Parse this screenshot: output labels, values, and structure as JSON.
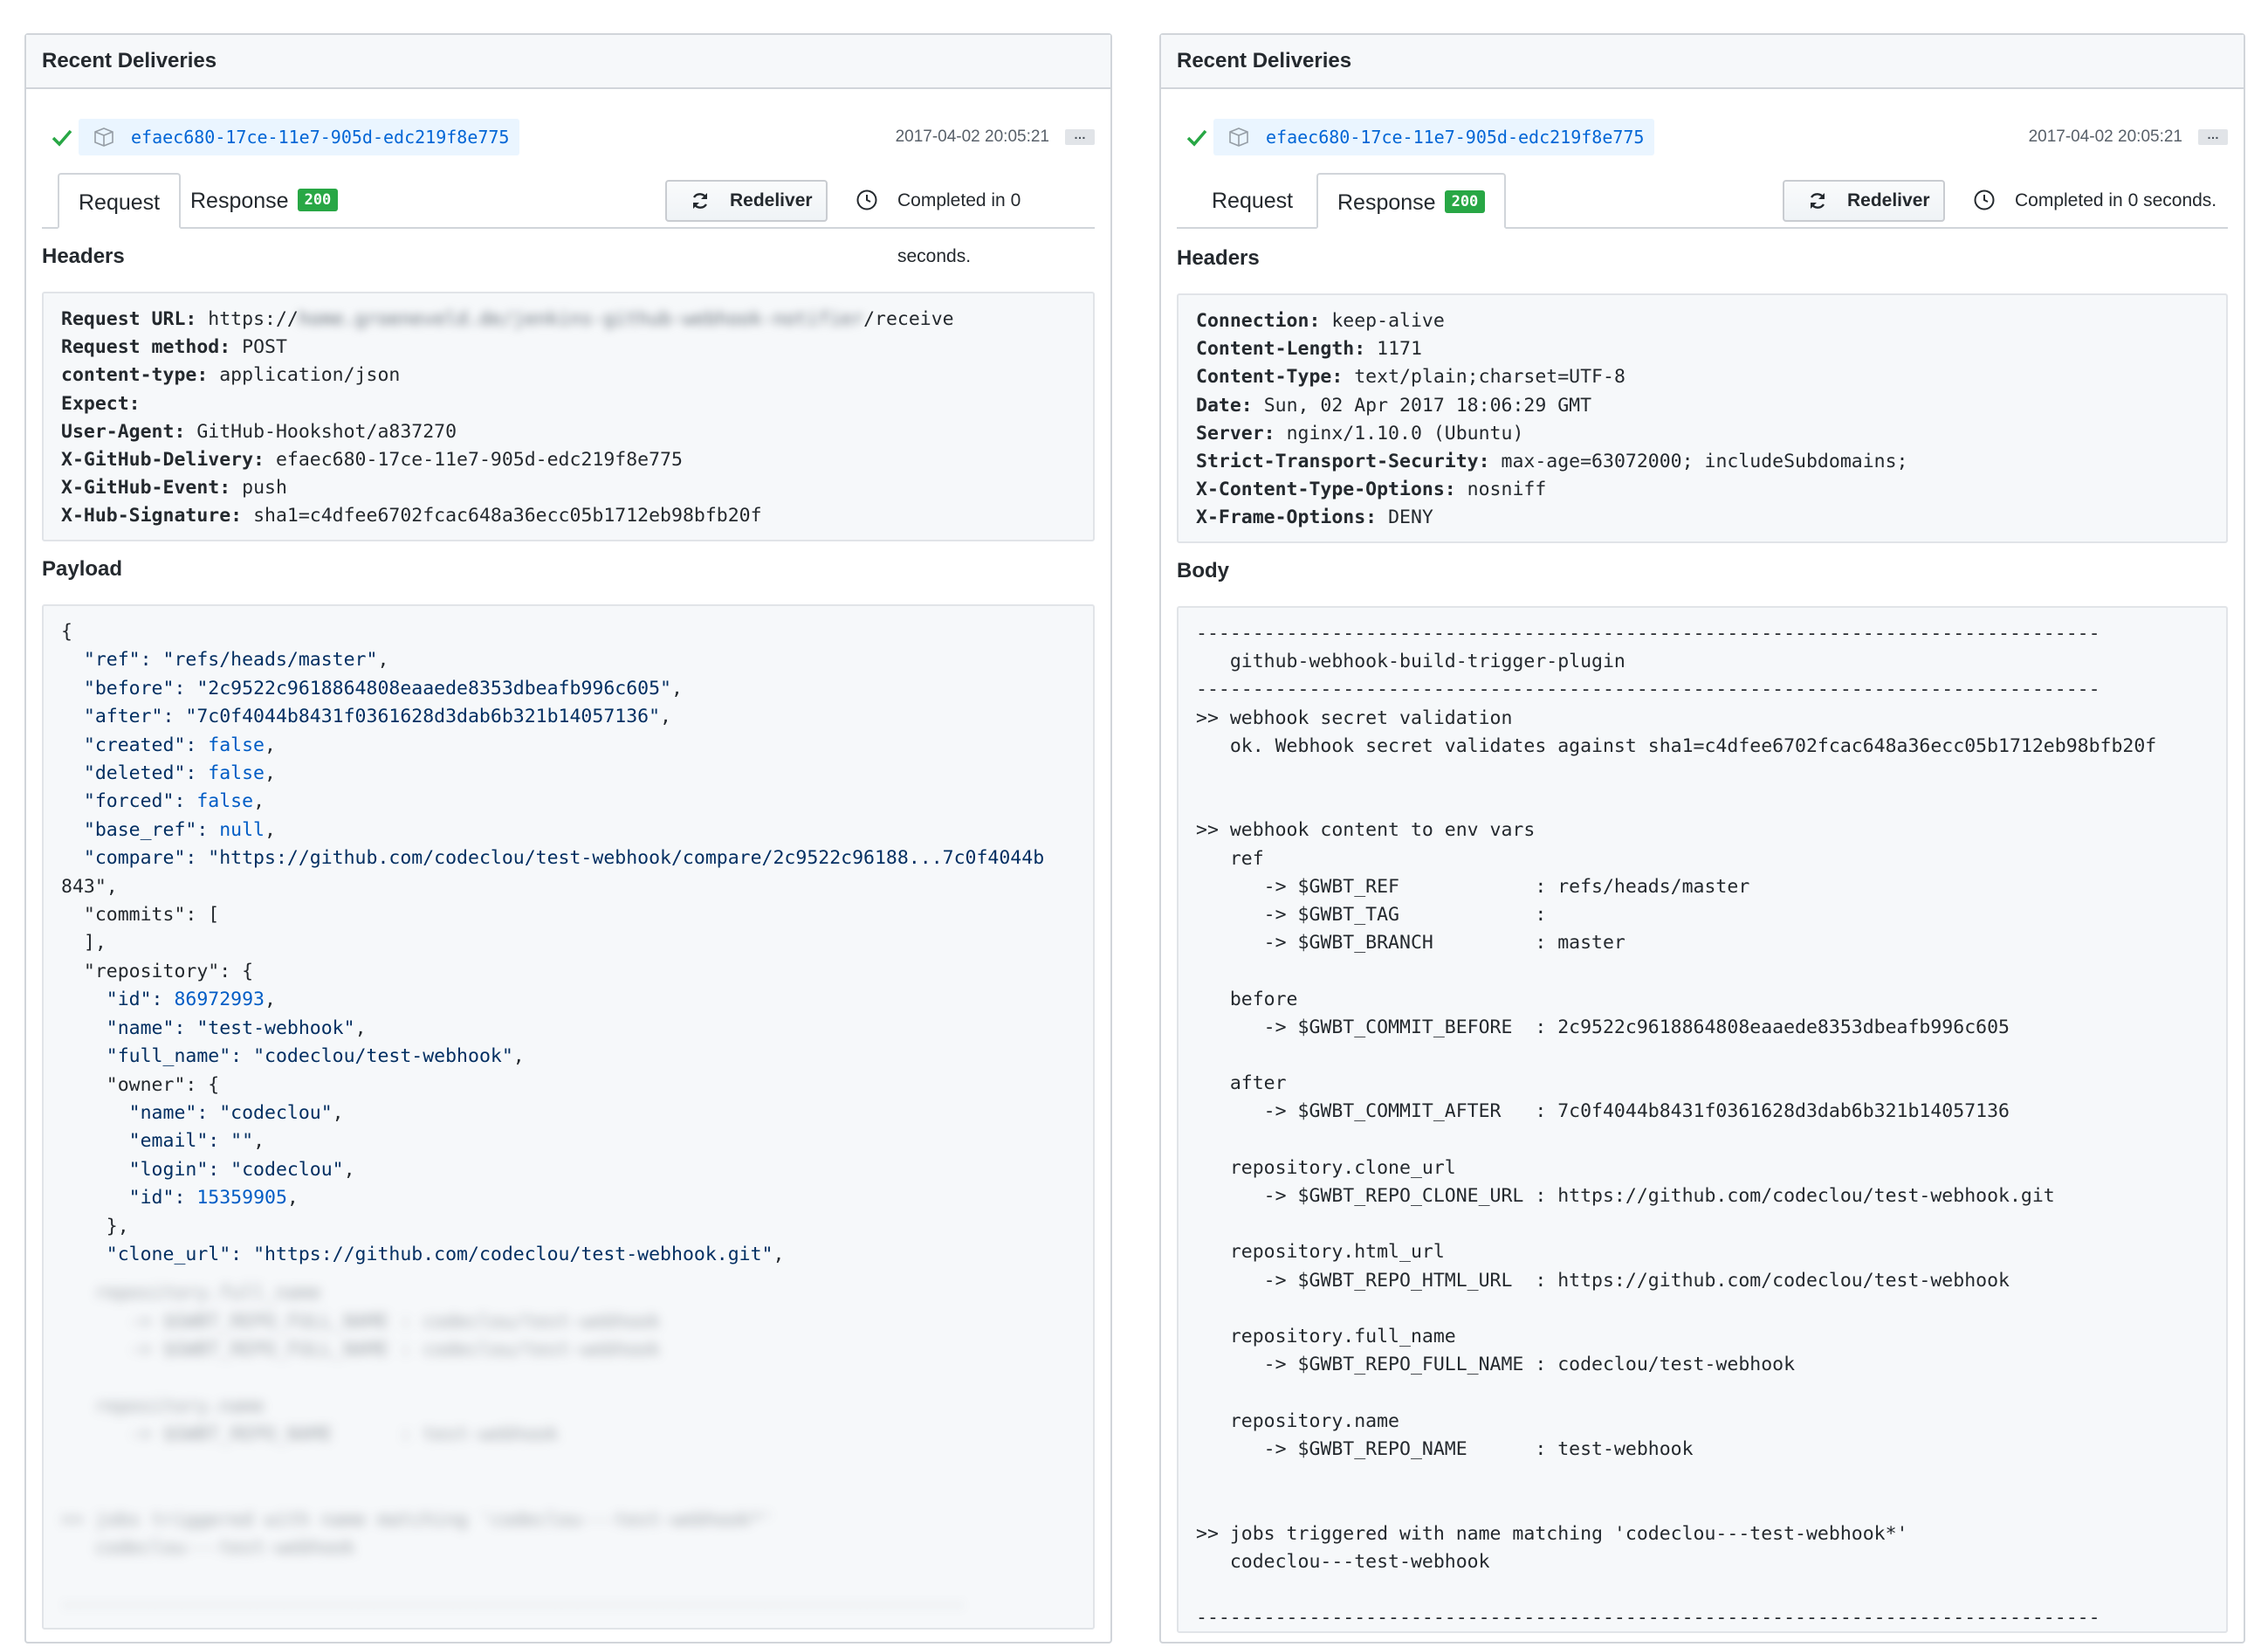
{
  "colors": {
    "accent": "#0366d6",
    "success": "#28a745",
    "code_bg": "#f6f8fa",
    "border": "#d1d5da"
  },
  "left": {
    "header_title": "Recent Deliveries",
    "delivery": {
      "status_icon": "check-icon",
      "guid": "efaec680-17ce-11e7-905d-edc219f8e775",
      "timestamp": "2017-04-02 20:05:21",
      "more_label": "…"
    },
    "tabs": {
      "request": "Request",
      "response": "Response",
      "response_badge": "200",
      "selected": "Request"
    },
    "redeliver_label": "Redeliver",
    "completed_text": "Completed in 0 seconds.",
    "headers_label": "Headers",
    "headers": [
      {
        "key": "Request URL:",
        "value": "https://",
        "blurred": "home.groeneveld.de/jenkins-github-webhook-notifier",
        "suffix": "/receive"
      },
      {
        "key": "Request method:",
        "value": "POST"
      },
      {
        "key": "content-type:",
        "value": "application/json"
      },
      {
        "key": "Expect:",
        "value": ""
      },
      {
        "key": "User-Agent:",
        "value": "GitHub-Hookshot/a837270"
      },
      {
        "key": "X-GitHub-Delivery:",
        "value": "efaec680-17ce-11e7-905d-edc219f8e775"
      },
      {
        "key": "X-GitHub-Event:",
        "value": "push"
      },
      {
        "key": "X-Hub-Signature:",
        "value": "sha1=c4dfee6702fcac648a36ecc05b1712eb98bfb20f"
      }
    ],
    "payload_label": "Payload",
    "payload": {
      "open": "{",
      "ref": [
        "  \"ref\": ",
        "\"refs/heads/master\"",
        ","
      ],
      "before": [
        "  \"before\": ",
        "\"2c9522c9618864808eaaede8353dbeafb996c605\"",
        ","
      ],
      "after": [
        "  \"after\": ",
        "\"7c0f4044b8431f0361628d3dab6b321b14057136\"",
        ","
      ],
      "created": [
        "  \"created\": ",
        "false",
        ","
      ],
      "deleted": [
        "  \"deleted\": ",
        "false",
        ","
      ],
      "forced": [
        "  \"forced\": ",
        "false",
        ","
      ],
      "base_ref": [
        "  \"base_ref\": ",
        "null",
        ","
      ],
      "compare": [
        "  \"compare\": ",
        "\"https://github.com/codeclou/test-webhook/compare/2c9522c96188...7c0f4044b",
        ""
      ],
      "compare_cont": "843\",",
      "commits": "  \"commits\": [",
      "commits_close": "  ],",
      "repository": "  \"repository\": {",
      "repo_id": [
        "    \"id\": ",
        "86972993",
        ","
      ],
      "repo_name": [
        "    \"name\": ",
        "\"test-webhook\"",
        ","
      ],
      "repo_full_name": [
        "    \"full_name\": ",
        "\"codeclou/test-webhook\"",
        ","
      ],
      "owner": "    \"owner\": {",
      "owner_name": [
        "      \"name\": ",
        "\"codeclou\"",
        ","
      ],
      "owner_email": [
        "      \"email\": ",
        "\"\"",
        ","
      ],
      "owner_login": [
        "      \"login\": ",
        "\"codeclou\"",
        ","
      ],
      "owner_id": [
        "      \"id\": ",
        "15359905",
        ","
      ],
      "owner_close": "    },",
      "clone_url": [
        "    \"clone_url\": ",
        "\"https://github.com/codeclou/test-webhook.git\"",
        ","
      ],
      "blurred_lines": [
        "   repository.full_name",
        "      -> $GWBT_REPO_FULL_NAME : codeclou/test-webhook",
        "      -> $GWBT_REPO_FULL_NAME : codeclou/test-webhook",
        "",
        "   repository.name",
        "      -> $GWBT_REPO_NAME      : test-webhook",
        "",
        "",
        ">> jobs triggered with name matching 'codeclou---test-webhook*'",
        "   codeclou---test-webhook",
        "",
        "--------------------------------------------------------------------------------"
      ]
    }
  },
  "right": {
    "header_title": "Recent Deliveries",
    "delivery": {
      "status_icon": "check-icon",
      "guid": "efaec680-17ce-11e7-905d-edc219f8e775",
      "timestamp": "2017-04-02 20:05:21",
      "more_label": "…"
    },
    "tabs": {
      "request": "Request",
      "response": "Response",
      "response_badge": "200",
      "selected": "Response"
    },
    "redeliver_label": "Redeliver",
    "completed_text": "Completed in 0 seconds.",
    "headers_label": "Headers",
    "headers": [
      {
        "key": "Connection:",
        "value": "keep-alive"
      },
      {
        "key": "Content-Length:",
        "value": "1171"
      },
      {
        "key": "Content-Type:",
        "value": "text/plain;charset=UTF-8"
      },
      {
        "key": "Date:",
        "value": "Sun, 02 Apr 2017 18:06:29 GMT"
      },
      {
        "key": "Server:",
        "value": "nginx/1.10.0 (Ubuntu)"
      },
      {
        "key": "Strict-Transport-Security:",
        "value": "max-age=63072000; includeSubdomains;"
      },
      {
        "key": "X-Content-Type-Options:",
        "value": "nosniff"
      },
      {
        "key": "X-Frame-Options:",
        "value": "DENY"
      }
    ],
    "body_label": "Body",
    "body_lines": [
      "--------------------------------------------------------------------------------",
      "   github-webhook-build-trigger-plugin",
      "--------------------------------------------------------------------------------",
      ">> webhook secret validation",
      "   ok. Webhook secret validates against sha1=c4dfee6702fcac648a36ecc05b1712eb98bfb20f",
      "",
      "",
      ">> webhook content to env vars",
      "   ref",
      "      -> $GWBT_REF            : refs/heads/master",
      "      -> $GWBT_TAG            :",
      "      -> $GWBT_BRANCH         : master",
      "",
      "   before",
      "      -> $GWBT_COMMIT_BEFORE  : 2c9522c9618864808eaaede8353dbeafb996c605",
      "",
      "   after",
      "      -> $GWBT_COMMIT_AFTER   : 7c0f4044b8431f0361628d3dab6b321b14057136",
      "",
      "   repository.clone_url",
      "      -> $GWBT_REPO_CLONE_URL : https://github.com/codeclou/test-webhook.git",
      "",
      "   repository.html_url",
      "      -> $GWBT_REPO_HTML_URL  : https://github.com/codeclou/test-webhook",
      "",
      "   repository.full_name",
      "      -> $GWBT_REPO_FULL_NAME : codeclou/test-webhook",
      "",
      "   repository.name",
      "      -> $GWBT_REPO_NAME      : test-webhook",
      "",
      "",
      ">> jobs triggered with name matching 'codeclou---test-webhook*'",
      "   codeclou---test-webhook",
      "",
      "--------------------------------------------------------------------------------"
    ]
  }
}
